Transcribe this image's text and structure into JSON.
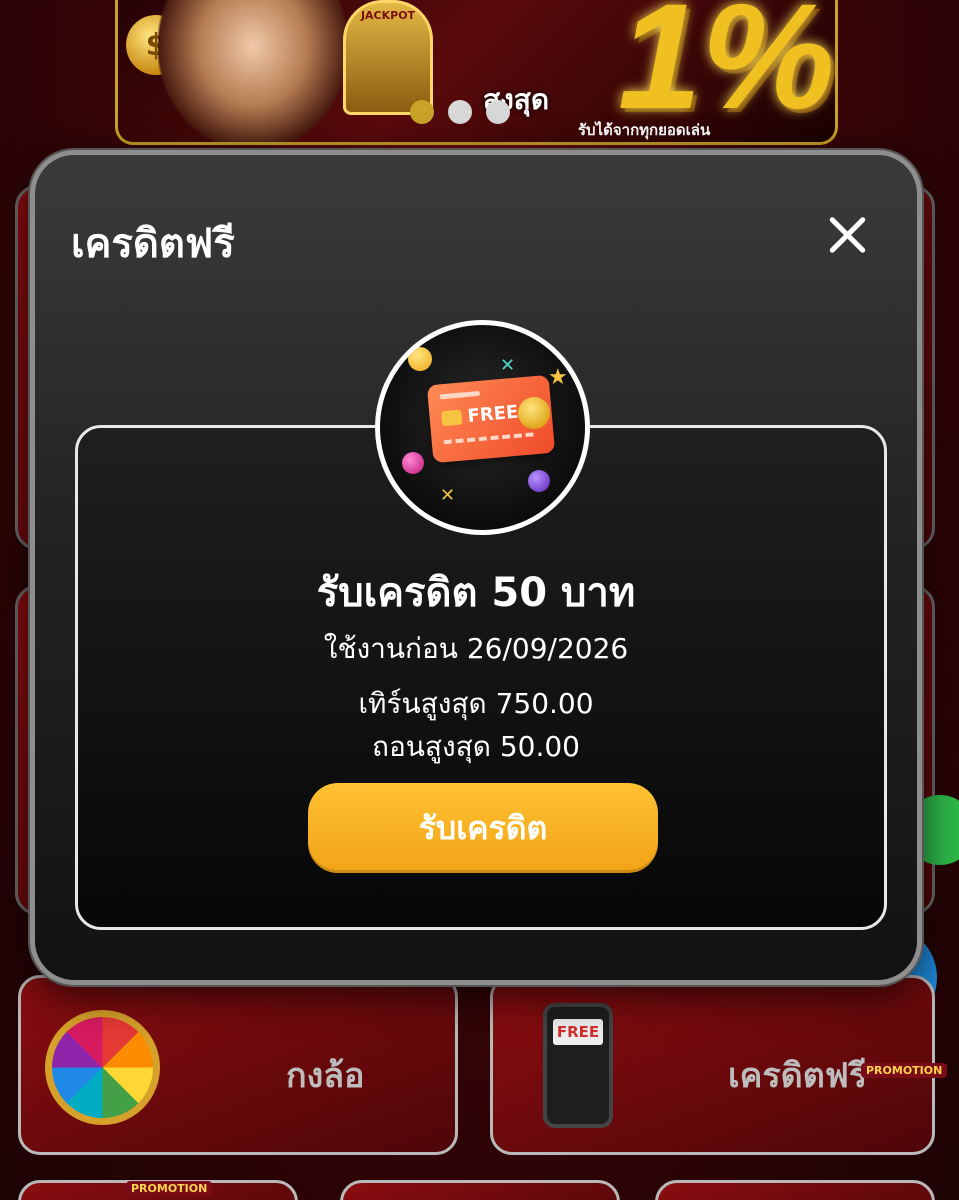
{
  "background": {
    "banner": {
      "slot_label": "JACKPOT",
      "percent_text": "1%",
      "max_label": "สูงสุด",
      "sub_text": "รับได้จากทุกยอดเล่น",
      "carousel_active_index": 0,
      "carousel_count": 3
    },
    "cards": {
      "wheel_label": "กงล้อ",
      "free_credit_label": "เครดิตฟรี",
      "phone_text": "FREE",
      "promo_tag": "PROMOTION"
    }
  },
  "modal": {
    "title": "เครดิตฟรี",
    "icon_card_text": "FREE",
    "credit_title": "รับเครดิต 50 บาท",
    "expiry": "ใช้งานก่อน 26/09/2026",
    "turnover": "เทิร์นสูงสุด 750.00",
    "withdraw": "ถอนสูงสุด 50.00",
    "claim_button": "รับเครดิต"
  },
  "colors": {
    "accent_gold": "#f2a316",
    "modal_bg": "#252525",
    "page_bg": "#3a0507"
  }
}
